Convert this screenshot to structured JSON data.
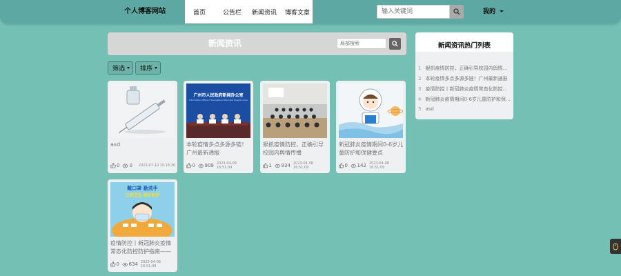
{
  "nav": {
    "brand": "个人博客网站",
    "links": [
      "首页",
      "公告栏",
      "新闻资讯",
      "博客文章"
    ],
    "search_placeholder": "输入关键词",
    "mine": "我的"
  },
  "main": {
    "title": "新闻资讯",
    "search_placeholder": "局部搜索",
    "filter": "筛选",
    "sort": "排序"
  },
  "cards": [
    {
      "title": "asd",
      "likes": "0",
      "views": "0",
      "date": "2023-07-10 15:18:36",
      "image": "syringe-image"
    },
    {
      "title": "本轮疫情多点多源多链！广州最新通报",
      "likes": "0",
      "views": "909",
      "date": "2023-04-08 16:51:09",
      "image": "press-conference-image"
    },
    {
      "title": "狠抓疫情防控，正确引导校园内舆情传播",
      "likes": "1",
      "views": "934",
      "date": "2023-04-08 16:51:09",
      "image": "meeting-room-image"
    },
    {
      "title": "新冠肺炎疫情期间0-6岁儿童防护和保健要点",
      "likes": "0",
      "views": "142",
      "date": "2023-04-08 16:51:09",
      "image": "astronaut-image"
    },
    {
      "title": "疫情防控丨新冠肺炎疫情常态化防控防护指南——",
      "likes": "0",
      "views": "634",
      "date": "2023-04-08 16:51:09",
      "image": "mask-poster-image"
    }
  ],
  "sidebar": {
    "title": "新闻资讯热门列表",
    "items": [
      {
        "idx": "1",
        "text": "狠抓疫情防控，正确引导校园内舆情传播"
      },
      {
        "idx": "2",
        "text": "本轮疫情多点多源多链！广州最新通报"
      },
      {
        "idx": "3",
        "text": "疫情防控丨新冠肺炎疫情常态化防控防护指南"
      },
      {
        "idx": "4",
        "text": "新冠肺炎疫情期间0-6岁儿童防护和保健要点"
      },
      {
        "idx": "5",
        "text": "asd"
      }
    ]
  },
  "banner_text": {
    "gov_title": "广州市人民政府新闻办公室",
    "gov_sub": "Information Office of Guangzhou Municipal People's Government",
    "poster_line1": "戴口罩 勤洗手",
    "poster_line2": "注意卫生 做好防护"
  }
}
